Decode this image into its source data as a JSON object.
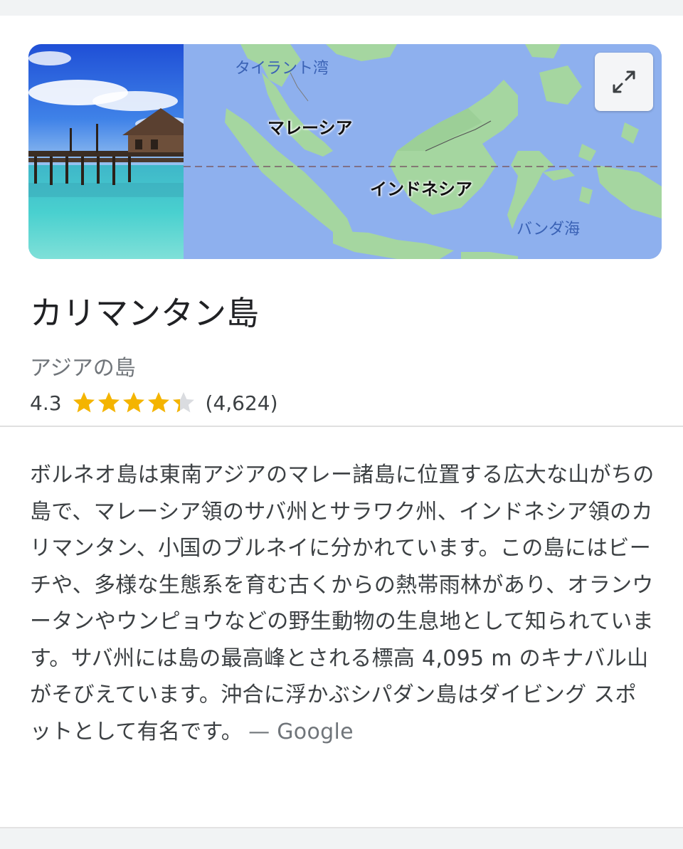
{
  "map": {
    "labels": {
      "gulf": "タイラント湾",
      "malaysia": "マレーシア",
      "indonesia": "インドネシア",
      "banda_sea": "バンダ海"
    },
    "expand_icon": "expand-arrows-icon"
  },
  "place": {
    "title": "カリマンタン島",
    "subtitle": "アジアの島",
    "rating": "4.3",
    "rating_value": 4.3,
    "review_count": "(4,624)",
    "star_color": "#f4b400"
  },
  "description": {
    "text": "ボルネオ島は東南アジアのマレー諸島に位置する広大な山がちの島で、マレーシア領のサバ州とサラワク州、インドネシア領のカリマンタン、小国のブルネイに分かれています。この島にはビーチや、多様な生態系を育む古くからの熱帯雨林があり、オランウータンやウンピョウなどの野生動物の生息地として知られています。サバ州には島の最高峰とされる標高 4,095 m のキナバル山がそびえています。沖合に浮かぶシパダン島はダイビング スポットとして有名です。",
    "source": "— Google"
  }
}
